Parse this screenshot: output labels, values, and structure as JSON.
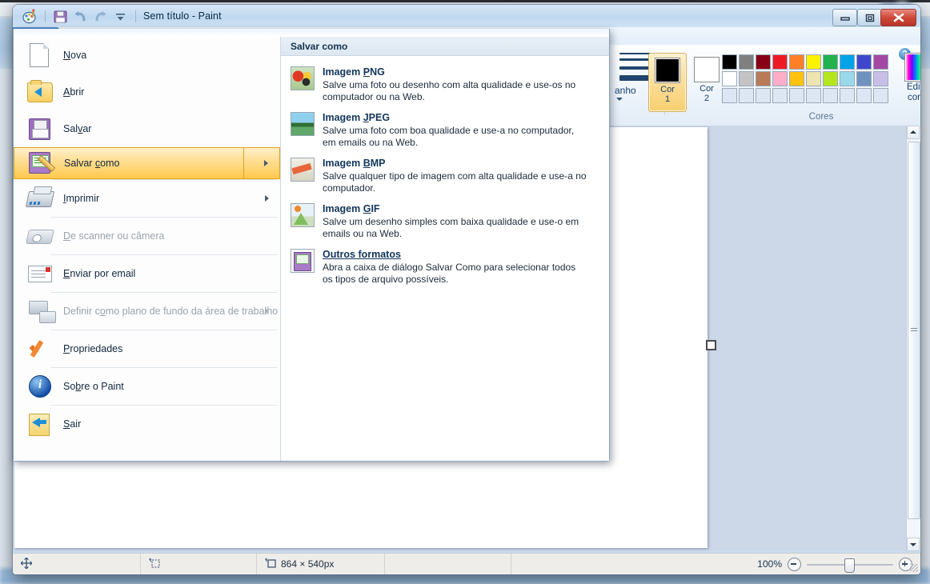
{
  "window": {
    "title": "Sem título - Paint",
    "quick_access": [
      "paint-icon",
      "save-icon",
      "undo-icon",
      "redo-icon",
      "customize-caret-icon"
    ],
    "buttons": {
      "minimize": "minimize-icon",
      "maximize": "maximize-icon",
      "close": "close-icon"
    },
    "help_glyph": "?"
  },
  "ribbon": {
    "paint_button": "paint-menu-button",
    "size_group_label": "anho",
    "colors": {
      "color1_label": "Cor",
      "color1_number": "1",
      "color1_value": "#000000",
      "color2_label": "Cor",
      "color2_number": "2",
      "color2_value": "#ffffff",
      "edit_colors_label_line1": "Editar",
      "edit_colors_label_line2": "cores",
      "group_caption": "Cores",
      "palette_row1": [
        "#000000",
        "#7f7f7f",
        "#880015",
        "#ed1c24",
        "#ff7f27",
        "#fff200",
        "#22b14c",
        "#00a2e8",
        "#3f48cc",
        "#a349a4"
      ],
      "palette_row2": [
        "#ffffff",
        "#c3c3c3",
        "#b97a57",
        "#ffaec9",
        "#ffc20e",
        "#efe4b0",
        "#b5e61d",
        "#99d9ea",
        "#7092be",
        "#c8bfe7"
      ],
      "palette_row3": [
        "",
        "",
        "",
        "",
        "",
        "",
        "",
        "",
        "",
        ""
      ]
    }
  },
  "appmenu": {
    "items": [
      {
        "label": "Nova",
        "accel": "N",
        "icon": "new-document-icon",
        "disabled": false,
        "submenu": false,
        "selected": false
      },
      {
        "label": "Abrir",
        "accel": "A",
        "icon": "open-folder-icon",
        "disabled": false,
        "submenu": false,
        "selected": false
      },
      {
        "label": "Salvar",
        "accel": "v",
        "icon": "save-disk-icon",
        "disabled": false,
        "submenu": false,
        "selected": false
      },
      {
        "label": "Salvar como",
        "accel": "c",
        "icon": "save-as-disk-icon",
        "disabled": false,
        "submenu": true,
        "selected": true
      },
      {
        "label": "Imprimir",
        "accel": "I",
        "icon": "printer-icon",
        "disabled": false,
        "submenu": true,
        "selected": false
      },
      {
        "label": "De scanner ou câmera",
        "accel": "D",
        "icon": "scanner-icon",
        "disabled": true,
        "submenu": false,
        "selected": false
      },
      {
        "label": "Enviar por email",
        "accel": "E",
        "icon": "mail-icon",
        "disabled": false,
        "submenu": false,
        "selected": false
      },
      {
        "label": "Definir como plano de fundo da área de trabalho",
        "accel": "o",
        "icon": "desktop-background-icon",
        "disabled": true,
        "submenu": true,
        "selected": false
      },
      {
        "label": "Propriedades",
        "accel": "P",
        "icon": "orange-check-icon",
        "disabled": false,
        "submenu": false,
        "selected": false
      },
      {
        "label": "Sobre o Paint",
        "accel": "b",
        "icon": "info-icon",
        "disabled": false,
        "submenu": false,
        "selected": false
      },
      {
        "label": "Sair",
        "accel": "S",
        "icon": "exit-icon",
        "disabled": false,
        "submenu": false,
        "selected": false
      }
    ],
    "labels": {
      "nova": "Nova",
      "abrir": "Abrir",
      "salvar": "Salvar",
      "salvar_como": "Salvar como",
      "imprimir": "Imprimir",
      "de_scanner": "De scanner ou câmera",
      "enviar_email": "Enviar por email",
      "definir_plano": "Definir como plano de fundo da área de trabalho",
      "propriedades": "Propriedades",
      "sobre": "Sobre o Paint",
      "sair": "Sair"
    },
    "panel": {
      "header": "Salvar como",
      "formats": [
        {
          "title": "Imagem PNG",
          "desc": "Salve uma foto ou desenho com alta qualidade e use-os no computador ou na Web.",
          "icon": "png-thumb-icon"
        },
        {
          "title": "Imagem JPEG",
          "desc": "Salve uma foto com boa qualidade e use-a no computador, em emails ou na Web.",
          "icon": "jpeg-thumb-icon"
        },
        {
          "title": "Imagem BMP",
          "desc": "Salve qualquer tipo de imagem com alta qualidade e use-a no computador.",
          "icon": "bmp-thumb-icon"
        },
        {
          "title": "Imagem GIF",
          "desc": "Salve um desenho simples com baixa qualidade e use-o em emails ou na Web.",
          "icon": "gif-thumb-icon"
        },
        {
          "title": "Outros formatos",
          "desc": "Abra a caixa de diálogo Salvar Como para selecionar todos os tipos de arquivo possíveis.",
          "icon": "other-formats-icon"
        }
      ]
    }
  },
  "statusbar": {
    "cursor_icon": "move-crosshair-icon",
    "selection_icon": "selection-size-icon",
    "image_size_icon": "image-size-icon",
    "image_size": "864 × 540px",
    "zoom_level": "100%",
    "zoom_out_icon": "zoom-out-icon",
    "zoom_in_icon": "zoom-in-icon"
  }
}
